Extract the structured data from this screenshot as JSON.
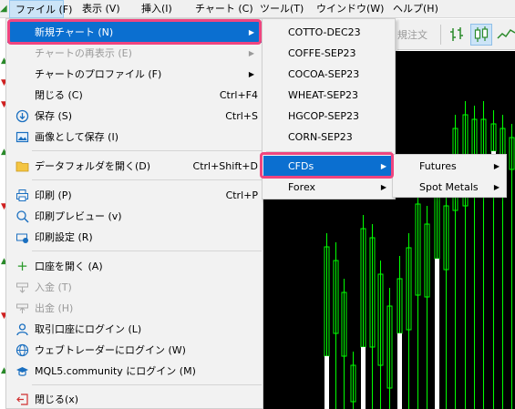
{
  "menubar": {
    "items": [
      {
        "label": "ファイル (F)"
      },
      {
        "label": "表示 (V)"
      },
      {
        "label": "挿入(I)"
      },
      {
        "label": "チャート (C)"
      },
      {
        "label": "ツール(T)"
      },
      {
        "label": "ウインドウ(W)"
      },
      {
        "label": "ヘルプ(H)"
      }
    ]
  },
  "toolbar": {
    "order_button_label": "規注文",
    "buttons": [
      {
        "icon": "bar-chart-icon"
      },
      {
        "icon": "candlestick-chart-icon"
      },
      {
        "icon": "line-chart-icon"
      }
    ]
  },
  "file_menu": {
    "items": [
      {
        "label": "新規チャート (N)",
        "shortcut": "",
        "icon": "",
        "submenu": true,
        "disabled": false
      },
      {
        "label": "チャートの再表示 (E)",
        "shortcut": "",
        "icon": "",
        "submenu": true,
        "disabled": true
      },
      {
        "label": "チャートのプロファイル (F)",
        "shortcut": "",
        "icon": "",
        "submenu": true,
        "disabled": false
      },
      {
        "label": "閉じる (C)",
        "shortcut": "Ctrl+F4",
        "icon": "",
        "submenu": false,
        "disabled": false
      },
      {
        "label": "保存 (S)",
        "shortcut": "Ctrl+S",
        "icon": "save-icon",
        "submenu": false,
        "disabled": false
      },
      {
        "label": "画像として保存 (I)",
        "shortcut": "",
        "icon": "image-icon",
        "submenu": false,
        "disabled": false
      },
      {
        "label": "データフォルダを開く(D)",
        "shortcut": "Ctrl+Shift+D",
        "icon": "folder-icon",
        "submenu": false,
        "disabled": false
      },
      {
        "label": "印刷 (P)",
        "shortcut": "Ctrl+P",
        "icon": "print-icon",
        "submenu": false,
        "disabled": false
      },
      {
        "label": "印刷プレビュー (v)",
        "shortcut": "",
        "icon": "print-preview-icon",
        "submenu": false,
        "disabled": false
      },
      {
        "label": "印刷設定 (R)",
        "shortcut": "",
        "icon": "print-settings-icon",
        "submenu": false,
        "disabled": false
      },
      {
        "label": "口座を開く (A)",
        "shortcut": "",
        "icon": "plus-icon",
        "submenu": false,
        "disabled": false
      },
      {
        "label": "入金 (T)",
        "shortcut": "",
        "icon": "deposit-icon",
        "submenu": false,
        "disabled": true
      },
      {
        "label": "出金 (H)",
        "shortcut": "",
        "icon": "withdraw-icon",
        "submenu": false,
        "disabled": true
      },
      {
        "label": "取引口座にログイン (L)",
        "shortcut": "",
        "icon": "user-icon",
        "submenu": false,
        "disabled": false
      },
      {
        "label": "ウェブトレーダーにログイン (W)",
        "shortcut": "",
        "icon": "globe-icon",
        "submenu": false,
        "disabled": false
      },
      {
        "label": "MQL5.community にログイン (M)",
        "shortcut": "",
        "icon": "mql5-cap-icon",
        "submenu": false,
        "disabled": false
      },
      {
        "label": "閉じる(x)",
        "shortcut": "",
        "icon": "exit-icon",
        "submenu": false,
        "disabled": false
      }
    ]
  },
  "symbol_menu": {
    "items": [
      {
        "label": "COTTO-DEC23",
        "submenu": false
      },
      {
        "label": "COFFE-SEP23",
        "submenu": false
      },
      {
        "label": "COCOA-SEP23",
        "submenu": false
      },
      {
        "label": "WHEAT-SEP23",
        "submenu": false
      },
      {
        "label": "HGCOP-SEP23",
        "submenu": false
      },
      {
        "label": "CORN-SEP23",
        "submenu": false
      },
      {
        "label": "CFDs",
        "submenu": true
      },
      {
        "label": "Forex",
        "submenu": true
      }
    ]
  },
  "cfd_menu": {
    "items": [
      {
        "label": "Futures",
        "submenu": true
      },
      {
        "label": "Spot Metals",
        "submenu": true
      }
    ]
  },
  "colors": {
    "highlight": "#0b6fd0",
    "annotation_frame": "#f0457f",
    "chart_background": "#000000",
    "candle": "#00ff00"
  }
}
